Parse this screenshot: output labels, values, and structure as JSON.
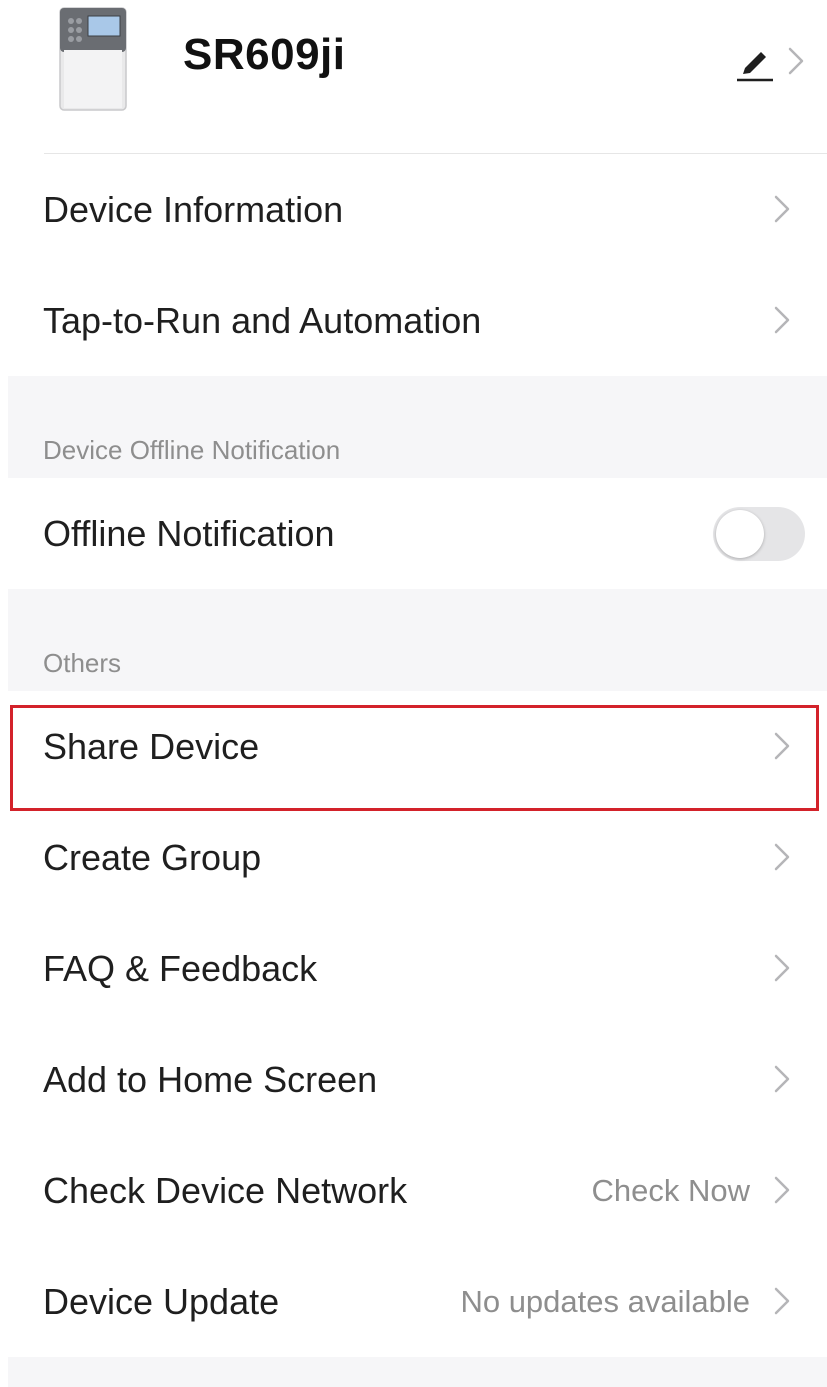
{
  "device": {
    "name": "SR609ji"
  },
  "rows": {
    "device_information": "Device Information",
    "tap_to_run": "Tap-to-Run and Automation",
    "offline_notification": "Offline Notification",
    "share_device": "Share Device",
    "create_group": "Create Group",
    "faq_feedback": "FAQ & Feedback",
    "add_home_screen": "Add to Home Screen",
    "check_network": "Check Device Network",
    "check_network_value": "Check Now",
    "device_update": "Device Update",
    "device_update_value": "No updates available"
  },
  "sections": {
    "offline_title": "Device Offline Notification",
    "others_title": "Others"
  },
  "toggles": {
    "offline_notification_on": false
  },
  "icons": {
    "edit": "pencil-icon",
    "chevron": "chevron-right-icon"
  },
  "colors": {
    "section_bg": "#f6f6f8",
    "highlight": "#d3222a",
    "secondary_text": "#8e8e8e"
  }
}
